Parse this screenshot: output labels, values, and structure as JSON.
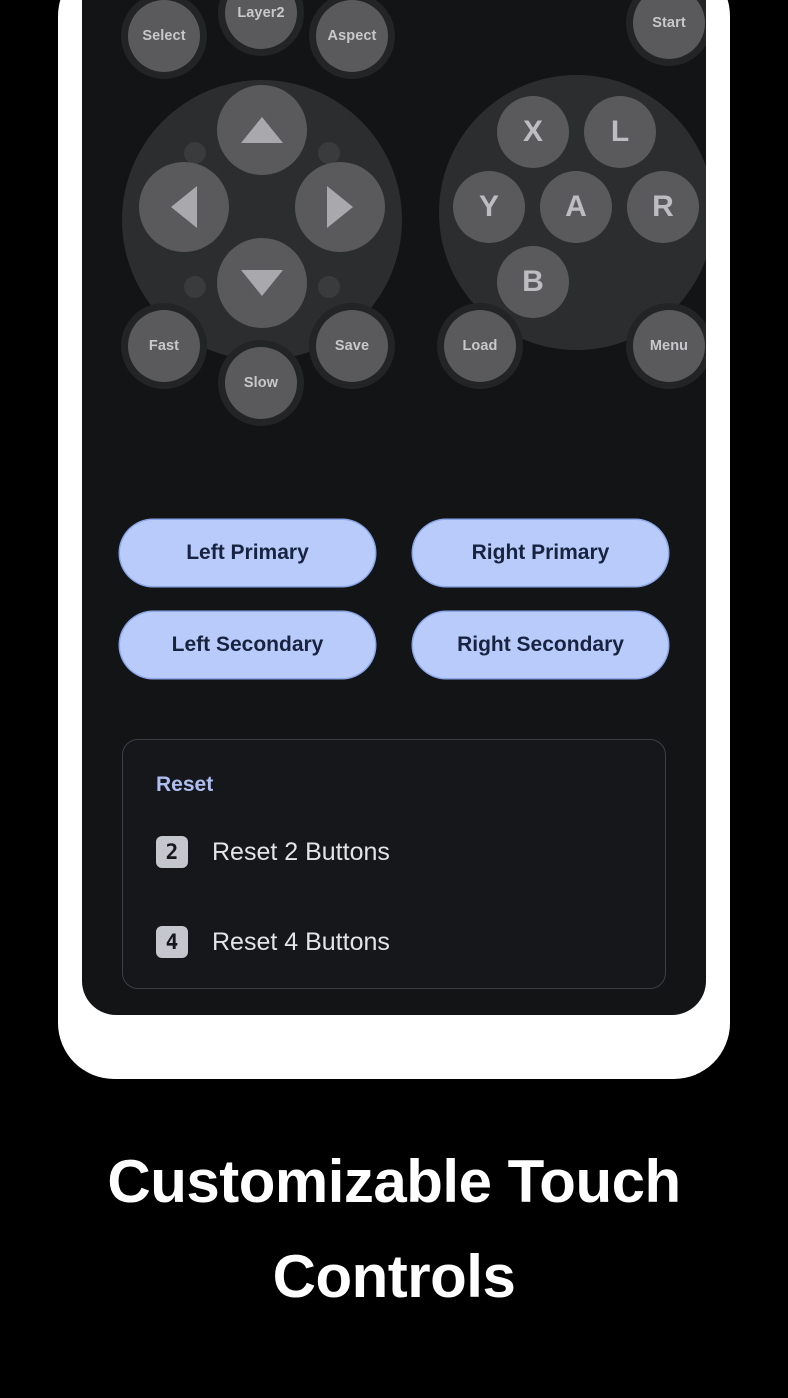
{
  "caption": "Customizable Touch Controls",
  "colors": {
    "frame": "#ffffff",
    "screen_bg": "#131416",
    "pad_button": "#5a5a5c",
    "pad_base": "#2c2d2f",
    "pad_label": "#c8c8cb",
    "pill_bg": "#b9cbfa",
    "pill_text": "#17233f",
    "reset_title": "#aebdf2",
    "card_border": "#3c3f45"
  },
  "gamepad": {
    "top_buttons": [
      {
        "label": "Select",
        "name": "pad-button-select"
      },
      {
        "label": "Layer2",
        "name": "pad-button-layer2"
      },
      {
        "label": "Aspect",
        "name": "pad-button-aspect"
      },
      {
        "label": "Start",
        "name": "pad-button-start"
      }
    ],
    "dpad": [
      {
        "label": "up",
        "name": "dpad-up-button",
        "icon": "triangle-up-icon"
      },
      {
        "label": "left",
        "name": "dpad-left-button",
        "icon": "triangle-left-icon"
      },
      {
        "label": "right",
        "name": "dpad-right-button",
        "icon": "triangle-right-icon"
      },
      {
        "label": "down",
        "name": "dpad-down-button",
        "icon": "triangle-down-icon"
      }
    ],
    "face_buttons": [
      {
        "label": "X",
        "name": "face-button-x"
      },
      {
        "label": "L",
        "name": "face-button-l"
      },
      {
        "label": "Y",
        "name": "face-button-y"
      },
      {
        "label": "A",
        "name": "face-button-a"
      },
      {
        "label": "R",
        "name": "face-button-r"
      },
      {
        "label": "B",
        "name": "face-button-b"
      }
    ],
    "bottom_buttons": [
      {
        "label": "Fast",
        "name": "pad-button-fast"
      },
      {
        "label": "Slow",
        "name": "pad-button-slow"
      },
      {
        "label": "Save",
        "name": "pad-button-save"
      },
      {
        "label": "Load",
        "name": "pad-button-load"
      },
      {
        "label": "Menu",
        "name": "pad-button-menu"
      }
    ]
  },
  "pills": {
    "row1": [
      {
        "label": "Left Primary",
        "name": "left-primary-button"
      },
      {
        "label": "Right Primary",
        "name": "right-primary-button"
      }
    ],
    "row2": [
      {
        "label": "Left Secondary",
        "name": "left-secondary-button"
      },
      {
        "label": "Right Secondary",
        "name": "right-secondary-button"
      }
    ]
  },
  "reset": {
    "title": "Reset",
    "items": [
      {
        "digit": "2",
        "label": "Reset 2 Buttons"
      },
      {
        "digit": "4",
        "label": "Reset 4 Buttons"
      }
    ]
  }
}
